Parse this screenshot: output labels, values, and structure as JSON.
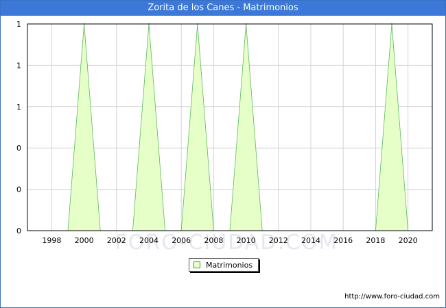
{
  "header": {
    "title": "Zorita de los Canes - Matrimonios"
  },
  "footer": {
    "credit": "http://www.foro-ciudad.com"
  },
  "watermark": "FORO-CIUDAD.COM",
  "colors": {
    "titlebar": "#3b78d8",
    "fill": "#e6ffc8",
    "line": "#5cb85c",
    "grid": "#d3d3d3"
  },
  "chart_data": {
    "type": "area",
    "title": "Zorita de los Canes - Matrimonios",
    "xlabel": "",
    "ylabel": "",
    "x": [
      1997,
      1998,
      1999,
      2000,
      2001,
      2002,
      2003,
      2004,
      2005,
      2006,
      2007,
      2008,
      2009,
      2010,
      2011,
      2012,
      2013,
      2014,
      2015,
      2016,
      2017,
      2018,
      2019,
      2020,
      2021
    ],
    "series": [
      {
        "name": "Matrimonios",
        "values": [
          0,
          0,
          0,
          1,
          0,
          0,
          0,
          1,
          0,
          0,
          1,
          0,
          0,
          1,
          0,
          0,
          0,
          0,
          0,
          0,
          0,
          0,
          1,
          0,
          0
        ]
      }
    ],
    "xlim": [
      1996.5,
      2021.5
    ],
    "ylim": [
      0,
      1
    ],
    "x_ticks": [
      "1998",
      "2000",
      "2002",
      "2004",
      "2006",
      "2008",
      "2010",
      "2012",
      "2014",
      "2016",
      "2018",
      "2020"
    ],
    "y_ticks": [
      "0",
      "0",
      "0",
      "1",
      "1",
      "1"
    ],
    "legend": {
      "position": "bottom",
      "label": "Matrimonios"
    },
    "grid": true
  }
}
